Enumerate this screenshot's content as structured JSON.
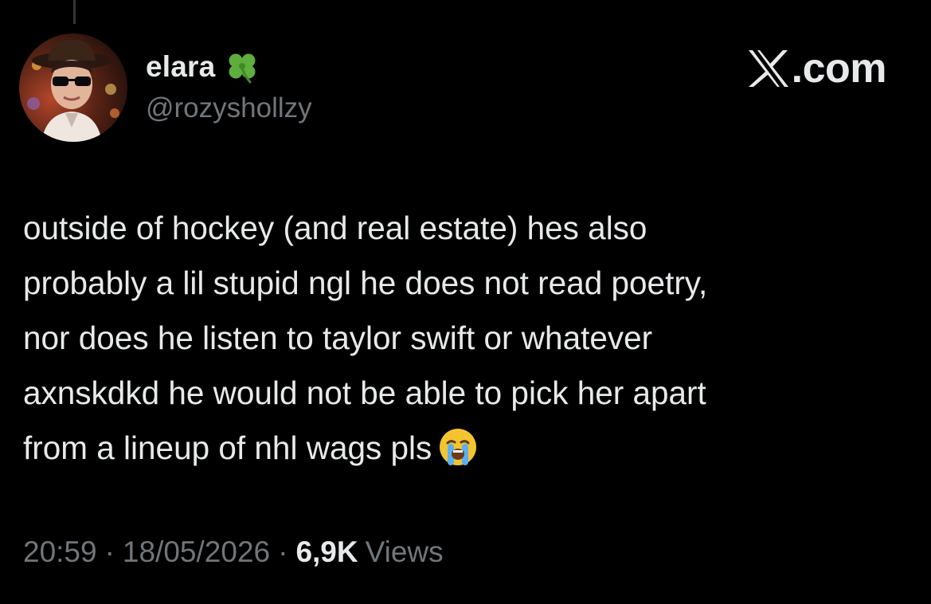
{
  "author": {
    "display_name": "elara",
    "handle": "@rozyshollzy",
    "badge_icon": "four-leaf-clover-icon",
    "avatar_icon": "profile-photo"
  },
  "brand": {
    "logo_icon": "x-logo-icon",
    "suffix": ".com"
  },
  "tweet": {
    "text": "outside of hockey (and real estate) hes also\nprobably a lil stupid ngl he does not read poetry,\nnor does he listen to taylor swift or whatever\naxnskdkd he would not be able to pick her apart\nfrom a lineup of nhl wags pls",
    "emoji_icon": "loudly-crying-face-icon"
  },
  "meta": {
    "time": "20:59",
    "separator": "·",
    "date": "18/05/2026",
    "views_count": "6,9K",
    "views_label": "Views"
  },
  "colors": {
    "background": "#000000",
    "primary_text": "#e7e9ea",
    "secondary_text": "#71767b",
    "clover_green": "#5fad3c"
  }
}
